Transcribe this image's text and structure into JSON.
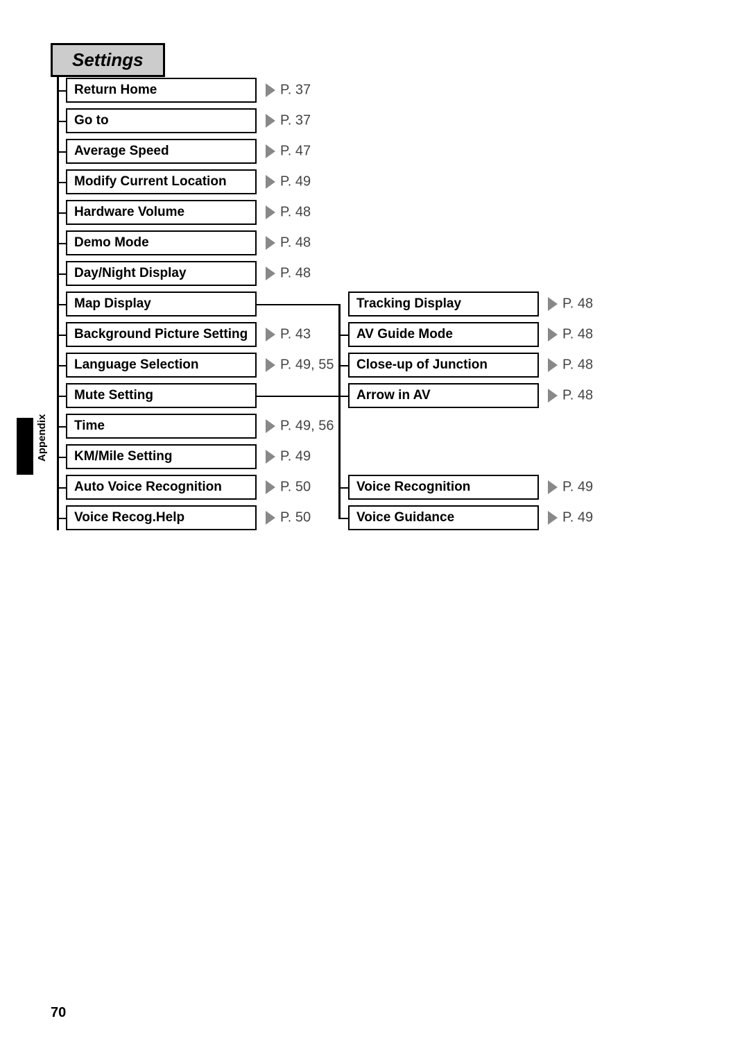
{
  "header": {
    "title": "Settings"
  },
  "side_label": "Appendix",
  "page_number": "70",
  "left_items": [
    {
      "label": "Return Home",
      "page": "P. 37"
    },
    {
      "label": "Go to",
      "page": "P. 37"
    },
    {
      "label": "Average Speed",
      "page": "P. 47"
    },
    {
      "label": "Modify Current Location",
      "page": "P. 49"
    },
    {
      "label": "Hardware Volume",
      "page": "P. 48"
    },
    {
      "label": "Demo Mode",
      "page": "P. 48"
    },
    {
      "label": "Day/Night Display",
      "page": "P. 48"
    },
    {
      "label": "Map Display",
      "page": ""
    },
    {
      "label": "Background Picture Setting",
      "page": "P. 43"
    },
    {
      "label": "Language Selection",
      "page": "P. 49, 55"
    },
    {
      "label": "Mute Setting",
      "page": ""
    },
    {
      "label": "Time",
      "page": "P. 49, 56"
    },
    {
      "label": "KM/Mile Setting",
      "page": "P. 49"
    },
    {
      "label": "Auto Voice Recognition",
      "page": "P. 50"
    },
    {
      "label": "Voice Recog.Help",
      "page": "P. 50"
    }
  ],
  "right_group_a": [
    {
      "label": "Tracking Display",
      "page": "P. 48"
    },
    {
      "label": "AV Guide Mode",
      "page": "P. 48"
    },
    {
      "label": "Close-up of Junction",
      "page": "P. 48"
    },
    {
      "label": "Arrow in AV",
      "page": "P. 48"
    }
  ],
  "right_group_b": [
    {
      "label": "Voice Recognition",
      "page": "P. 49"
    },
    {
      "label": "Voice Guidance",
      "page": "P. 49"
    }
  ]
}
